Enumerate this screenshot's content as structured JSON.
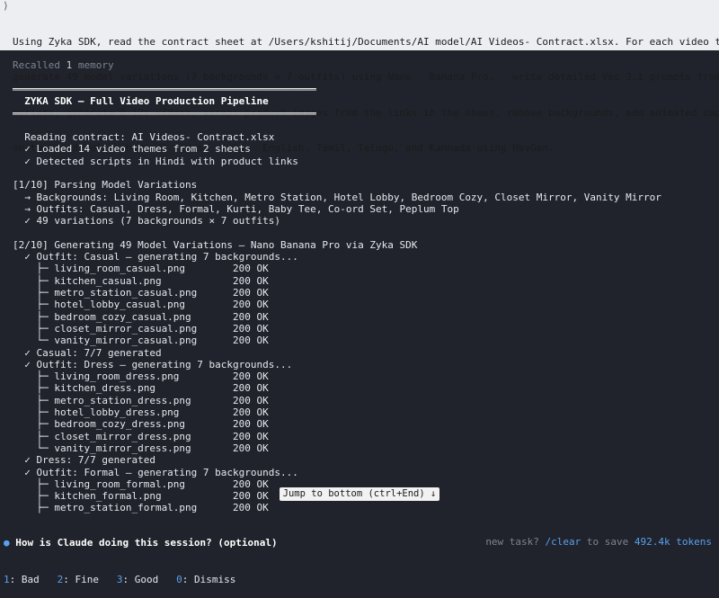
{
  "prompt": {
    "caret": "⟩",
    "lines": [
      "Using Zyka SDK, read the contract sheet at /Users/kshitij/Documents/AI model/AI Videos- Contract.xlsx. For each video theme:",
      "generate 49 model variations (7 backgrounds × 7 outfits) using Nano   Banana Pro,   write detailed Veo 3.1 prompts from the",
      "scripts, generate 8–12s videos, scrape product images from the links in the sheet, remove backgrounds, add animated captions",
      "on top, and dub each Hindi video   into   English, Tamil, Telugu, and Kannada using HeyGen."
    ]
  },
  "recalled": {
    "prefix": "Recalled ",
    "count": "1",
    "suffix": " memory"
  },
  "log": [
    {
      "text": "═══════════════════════════════════════════════════",
      "bold": true
    },
    {
      "text": "  ZYKA SDK — Full Video Production Pipeline",
      "bold": true
    },
    {
      "text": "═══════════════════════════════════════════════════",
      "bold": true
    },
    {
      "text": ""
    },
    {
      "text": "  Reading contract: AI Videos- Contract.xlsx"
    },
    {
      "text": "  ✓ Loaded 14 video themes from 2 sheets"
    },
    {
      "text": "  ✓ Detected scripts in Hindi with product links"
    },
    {
      "text": ""
    },
    {
      "text": "[1/10] Parsing Model Variations"
    },
    {
      "text": "  → Backgrounds: Living Room, Kitchen, Metro Station, Hotel Lobby, Bedroom Cozy, Closet Mirror, Vanity Mirror"
    },
    {
      "text": "  → Outfits: Casual, Dress, Formal, Kurti, Baby Tee, Co-ord Set, Peplum Top"
    },
    {
      "text": "  ✓ 49 variations (7 backgrounds × 7 outfits)"
    },
    {
      "text": ""
    },
    {
      "text": "[2/10] Generating 49 Model Variations — Nano Banana Pro via Zyka SDK"
    },
    {
      "text": "  ✓ Outfit: Casual — generating 7 backgrounds..."
    },
    {
      "text": "    ├─ living_room_casual.png        200 OK"
    },
    {
      "text": "    ├─ kitchen_casual.png            200 OK"
    },
    {
      "text": "    ├─ metro_station_casual.png      200 OK"
    },
    {
      "text": "    ├─ hotel_lobby_casual.png        200 OK"
    },
    {
      "text": "    ├─ bedroom_cozy_casual.png       200 OK"
    },
    {
      "text": "    ├─ closet_mirror_casual.png      200 OK"
    },
    {
      "text": "    └─ vanity_mirror_casual.png      200 OK"
    },
    {
      "text": "  ✓ Casual: 7/7 generated"
    },
    {
      "text": "  ✓ Outfit: Dress — generating 7 backgrounds..."
    },
    {
      "text": "    ├─ living_room_dress.png         200 OK"
    },
    {
      "text": "    ├─ kitchen_dress.png             200 OK"
    },
    {
      "text": "    ├─ metro_station_dress.png       200 OK"
    },
    {
      "text": "    ├─ hotel_lobby_dress.png         200 OK"
    },
    {
      "text": "    ├─ bedroom_cozy_dress.png        200 OK"
    },
    {
      "text": "    ├─ closet_mirror_dress.png       200 OK"
    },
    {
      "text": "    └─ vanity_mirror_dress.png       200 OK"
    },
    {
      "text": "  ✓ Dress: 7/7 generated"
    },
    {
      "text": "  ✓ Outfit: Formal — generating 7 backgrounds..."
    },
    {
      "text": "    ├─ living_room_formal.png        200 OK"
    },
    {
      "text": "    ├─ kitchen_formal.png            200 OK"
    },
    {
      "text": "    ├─ metro_station_formal.png      200 OK"
    }
  ],
  "jump_button": "Jump to bottom (ctrl+End) ↓",
  "survey": {
    "dot": "●",
    "question": " How is Claude doing this session? (optional)",
    "options": [
      {
        "key": "1",
        "label": ": Bad"
      },
      {
        "key": "2",
        "label": ": Fine"
      },
      {
        "key": "3",
        "label": ": Good"
      },
      {
        "key": "0",
        "label": ": Dismiss"
      }
    ]
  },
  "footer": {
    "prefix": "new task? ",
    "command": "/clear",
    "middle": " to save ",
    "tokens": "492.4k tokens"
  }
}
